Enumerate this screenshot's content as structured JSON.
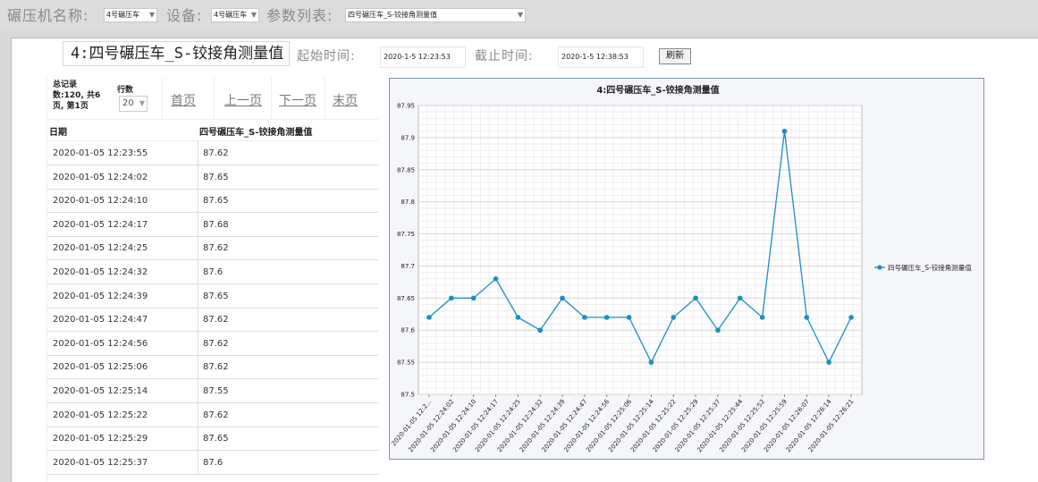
{
  "filter_bar": {
    "machine_label": "碾压机名称:",
    "machine_value": "4号碾压车",
    "device_label": "设备:",
    "device_value": "4号碾压车",
    "param_label": "参数列表:",
    "param_value": "四号碾压车_S-铰接角测量值"
  },
  "header": {
    "title": "4:四号碾压车_S-铰接角测量值",
    "start_label": "起始时间:",
    "start_value": "2020-1-5 12:23:53",
    "end_label": "截止时间:",
    "end_value": "2020-1-5 12:38:53",
    "refresh_label": "刷新"
  },
  "pager": {
    "info": "总记录数:120, 共6页, 第1页",
    "rows_label": "行数",
    "rows_value": "20",
    "first": "首页",
    "prev": "上一页",
    "next": "下一页",
    "last": "末页"
  },
  "table": {
    "columns": [
      "日期",
      "四号碾压车_S-铰接角测量值"
    ],
    "rows": [
      [
        "2020-01-05 12:23:55",
        "87.62"
      ],
      [
        "2020-01-05 12:24:02",
        "87.65"
      ],
      [
        "2020-01-05 12:24:10",
        "87.65"
      ],
      [
        "2020-01-05 12:24:17",
        "87.68"
      ],
      [
        "2020-01-05 12:24:25",
        "87.62"
      ],
      [
        "2020-01-05 12:24:32",
        "87.6"
      ],
      [
        "2020-01-05 12:24:39",
        "87.65"
      ],
      [
        "2020-01-05 12:24:47",
        "87.62"
      ],
      [
        "2020-01-05 12:24:56",
        "87.62"
      ],
      [
        "2020-01-05 12:25:06",
        "87.62"
      ],
      [
        "2020-01-05 12:25:14",
        "87.55"
      ],
      [
        "2020-01-05 12:25:22",
        "87.62"
      ],
      [
        "2020-01-05 12:25:29",
        "87.65"
      ],
      [
        "2020-01-05 12:25:37",
        "87.6"
      ]
    ]
  },
  "chart_data": {
    "type": "line",
    "title": "4:四号碾压车_S-铰接角测量值",
    "xlabel": "",
    "ylabel": "",
    "ylim": [
      87.5,
      87.95
    ],
    "yticks": [
      "87.5",
      "87.55",
      "87.6",
      "87.65",
      "87.7",
      "87.75",
      "87.8",
      "87.85",
      "87.9",
      "87.95"
    ],
    "grid": true,
    "legend": "right",
    "color": "#1a8fc6",
    "x": [
      "2020-01-05 12:2...",
      "2020-01-05 12:24:02",
      "2020-01-05 12:24:10",
      "2020-01-05 12:24:17",
      "2020-01-05 12:24:25",
      "2020-01-05 12:24:32",
      "2020-01-05 12:24:39",
      "2020-01-05 12:24:47",
      "2020-01-05 12:24:56",
      "2020-01-05 12:25:06",
      "2020-01-05 12:25:14",
      "2020-01-05 12:25:22",
      "2020-01-05 12:25:29",
      "2020-01-05 12:25:37",
      "2020-01-05 12:25:44",
      "2020-01-05 12:25:52",
      "2020-01-05 12:25:59",
      "2020-01-05 12:26:07",
      "2020-01-05 12:26:14",
      "2020-01-05 12:26:21"
    ],
    "series": [
      {
        "name": "四号碾压车_S-铰接角测量值",
        "values": [
          87.62,
          87.65,
          87.65,
          87.68,
          87.62,
          87.6,
          87.65,
          87.62,
          87.62,
          87.62,
          87.55,
          87.62,
          87.65,
          87.6,
          87.65,
          87.62,
          87.91,
          87.62,
          87.55,
          87.62
        ]
      }
    ]
  }
}
